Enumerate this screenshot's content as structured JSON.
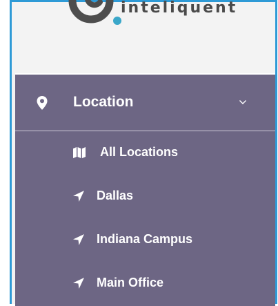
{
  "brand": {
    "logo_text": "inteliquent"
  },
  "menu": {
    "section": {
      "label": "Location",
      "icon": "map-pin-icon",
      "expanded": true
    },
    "items": [
      {
        "label": "All Locations",
        "icon": "map-icon"
      },
      {
        "label": "Dallas",
        "icon": "location-arrow-icon"
      },
      {
        "label": "Indiana Campus",
        "icon": "location-arrow-icon"
      },
      {
        "label": "Main Office",
        "icon": "location-arrow-icon"
      }
    ]
  },
  "colors": {
    "menu_bg": "#6d6684",
    "frame_accent": "#2e9ad6",
    "text": "#ffffff"
  }
}
